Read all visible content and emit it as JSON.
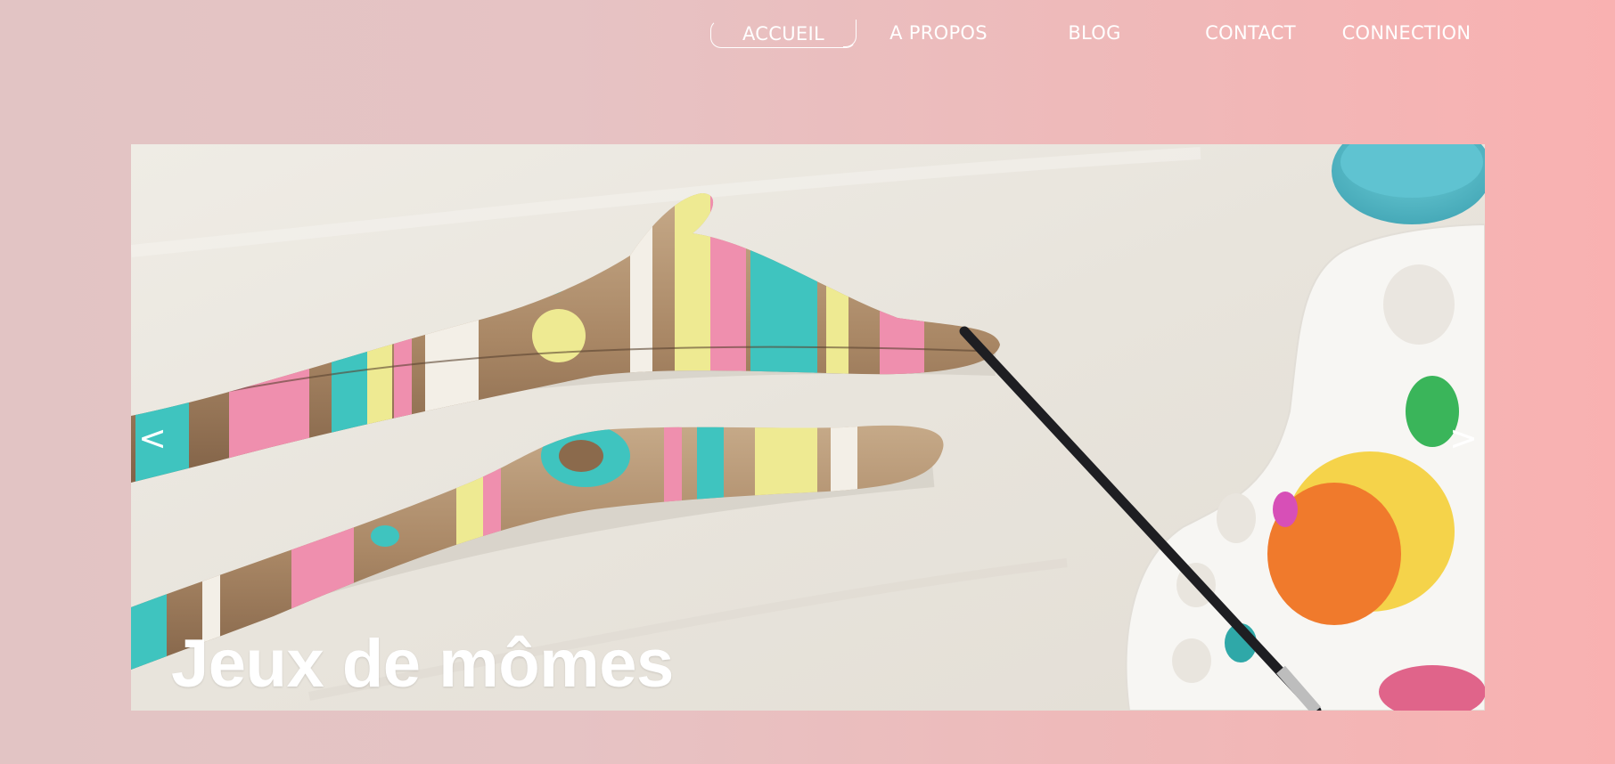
{
  "nav": {
    "items": [
      {
        "label": "ACCUEIL",
        "active": true
      },
      {
        "label": "A PROPOS"
      },
      {
        "label": "BLOG"
      },
      {
        "label": "CONTACT"
      },
      {
        "label": "CONNECTION"
      }
    ]
  },
  "carousel": {
    "prev_label": "<",
    "next_label": ">",
    "title": "Jeux de mômes",
    "image": "painted-driftwood-sticks-with-paintbrush-and-palette"
  },
  "colors": {
    "background_left": "#e2c4c4",
    "background_right": "#f9b1b1",
    "text": "#ffffff",
    "paint_pink": "#ef8fae",
    "paint_teal": "#3fc4bf",
    "paint_yellow": "#eeea92",
    "paint_orange": "#f07a2c"
  }
}
